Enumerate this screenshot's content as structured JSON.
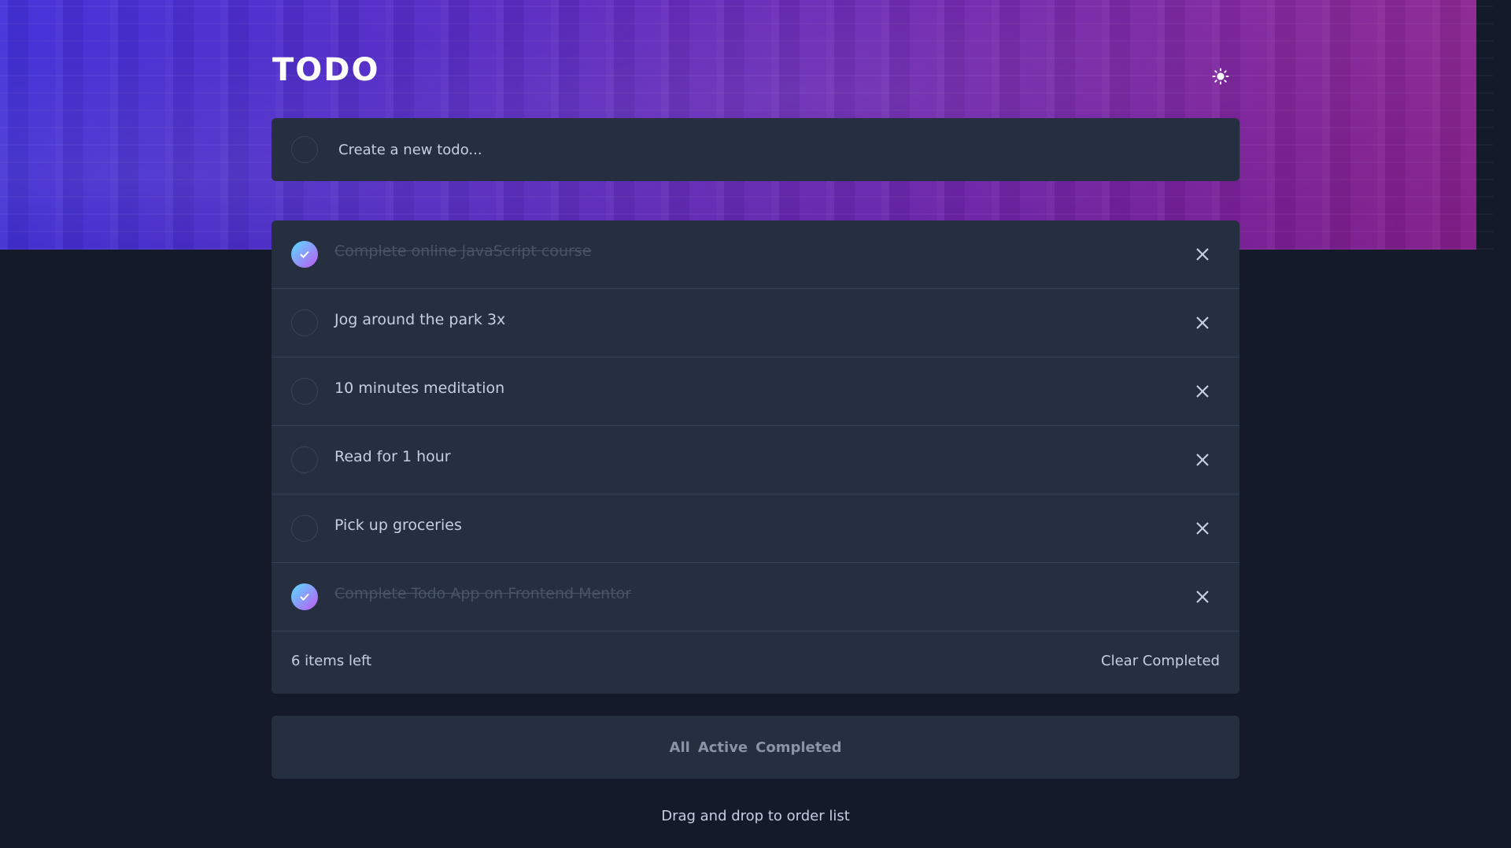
{
  "app": {
    "title": "TODO",
    "accent_gradient": [
      "#57ddff",
      "#c058f3"
    ]
  },
  "theme_toggle": {
    "icon": "sun-icon"
  },
  "new_todo": {
    "placeholder": "Create a new todo...",
    "value": ""
  },
  "todos": [
    {
      "text": "Complete online JavaScript course",
      "completed": true
    },
    {
      "text": "Jog around the park 3x",
      "completed": false
    },
    {
      "text": "10 minutes meditation",
      "completed": false
    },
    {
      "text": "Read for 1 hour",
      "completed": false
    },
    {
      "text": "Pick up groceries",
      "completed": false
    },
    {
      "text": "Complete Todo App on Frontend Mentor",
      "completed": true
    }
  ],
  "footer": {
    "items_left": "6 items left",
    "clear_label": "Clear Completed"
  },
  "filters": {
    "all": "All",
    "active": "Active",
    "completed": "Completed"
  },
  "hint": "Drag and drop to order list",
  "colors": {
    "background": "#141a2a",
    "card": "#252f3f",
    "text": "#c9cde2",
    "done_text": "#4a5367"
  }
}
